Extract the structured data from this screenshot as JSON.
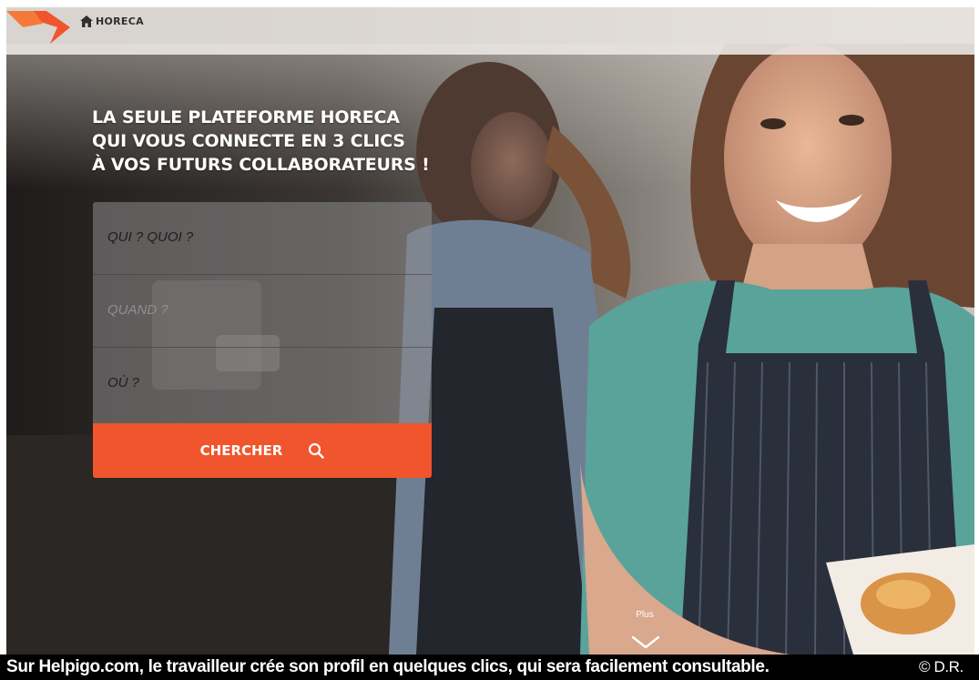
{
  "brand": {
    "name": "HORECA",
    "accent_color": "#f0552d"
  },
  "hero": {
    "headline_lines": [
      "LA SEULE PLATEFORME HORECA",
      "QUI VOUS CONNECTE EN 3 CLICS",
      "À VOS FUTURS COLLABORATEURS !"
    ]
  },
  "search": {
    "what_placeholder": "QUI ? QUOI ?",
    "when_placeholder": "QUAND ?",
    "where_placeholder": "OÙ ?",
    "button_label": "CHERCHER",
    "button_icon": "search-icon"
  },
  "more": {
    "label": "Plus",
    "icon": "chevron-down-icon"
  },
  "caption": {
    "text": "Sur Helpigo.com, le travailleur crée son profil en quelques clics, qui sera facilement consultable.",
    "credit": "© D.R."
  }
}
